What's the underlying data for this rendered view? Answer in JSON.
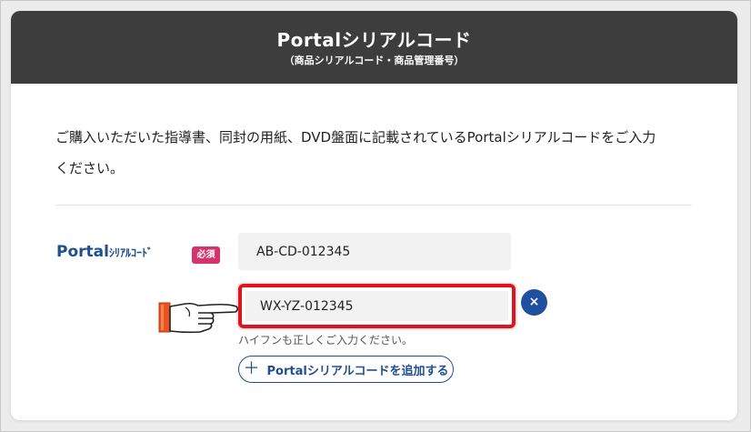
{
  "header": {
    "title": "Portalシリアルコード",
    "subtitle": "（商品シリアルコード・商品管理番号）"
  },
  "instructions": {
    "line1": "ご購入いただいた指導書、同封の用紙、DVD盤面に記載されているPortalシリアルコードをご入力",
    "line2": "ください。"
  },
  "field": {
    "label_main": "Portal",
    "label_small": "ｼﾘｱﾙｺｰﾄﾞ",
    "required_badge": "必須",
    "inputs": [
      {
        "value": "AB-CD-012345"
      },
      {
        "value": "WX-YZ-012345"
      }
    ],
    "clear_icon": "×",
    "hint": "ハイフンも正しくご入力ください。",
    "add_button_label": "Portalシリアルコードを追加する",
    "add_icon": "＋"
  },
  "colors": {
    "header_bg": "#3d3d3d",
    "accent_blue": "#1f4f8f",
    "required_pink": "#d6336c",
    "highlight_red": "#e0141e"
  }
}
